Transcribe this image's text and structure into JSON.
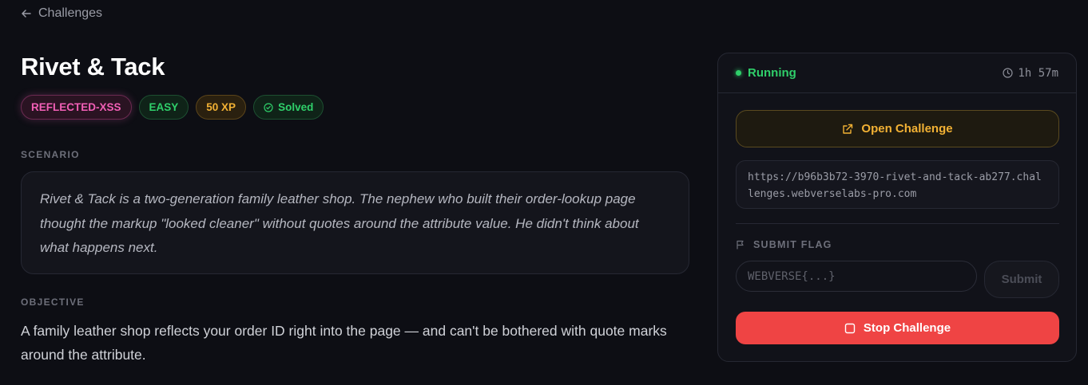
{
  "nav": {
    "back_label": "Challenges"
  },
  "challenge": {
    "title": "Rivet & Tack",
    "tags": {
      "category": "REFLECTED-XSS",
      "difficulty": "EASY",
      "xp": "50 XP",
      "status": "Solved"
    },
    "scenario_label": "SCENARIO",
    "scenario": "Rivet & Tack is a two-generation family leather shop. The nephew who built their order-lookup page thought the markup \"looked cleaner\" without quotes around the attribute value. He didn't think about what happens next.",
    "objective_label": "OBJECTIVE",
    "objective": "A family leather shop reflects your order ID right into the page — and can't be bothered with quote marks around the attribute."
  },
  "panel": {
    "status": "Running",
    "timer": "1h 57m",
    "open_label": "Open Challenge",
    "url": "https://b96b3b72-3970-rivet-and-tack-ab277.challenges.webverselabs-pro.com",
    "flag_label": "SUBMIT FLAG",
    "flag_placeholder": "WEBVERSE{...}",
    "submit_label": "Submit",
    "stop_label": "Stop Challenge"
  },
  "colors": {
    "background": "#0d0e14",
    "running_green": "#2fcf6a",
    "xss_pink": "#f25fb6",
    "xp_amber": "#f2b134",
    "stop_red": "#ef4444"
  }
}
